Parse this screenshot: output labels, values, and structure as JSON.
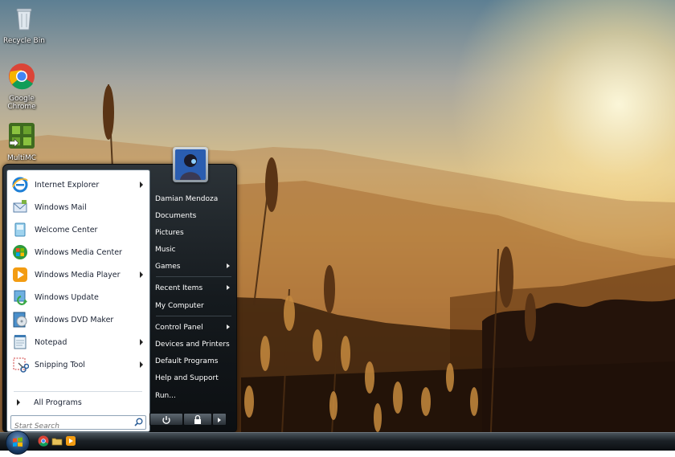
{
  "desktop": {
    "icons": [
      {
        "label": "Recycle Bin",
        "icon": "recycle-bin-icon"
      },
      {
        "label": "Google Chrome",
        "icon": "chrome-icon"
      },
      {
        "label": "MultiMC",
        "icon": "multimc-icon"
      }
    ]
  },
  "start_menu": {
    "programs": [
      {
        "label": "Internet Explorer",
        "icon": "internet-explorer-icon",
        "has_submenu": true
      },
      {
        "label": "Windows Mail",
        "icon": "mail-icon",
        "has_submenu": false
      },
      {
        "label": "Welcome Center",
        "icon": "welcome-center-icon",
        "has_submenu": false
      },
      {
        "label": "Windows Media Center",
        "icon": "media-center-icon",
        "has_submenu": false
      },
      {
        "label": "Windows Media Player",
        "icon": "media-player-icon",
        "has_submenu": true
      },
      {
        "label": "Windows Update",
        "icon": "windows-update-icon",
        "has_submenu": false
      },
      {
        "label": "Windows DVD Maker",
        "icon": "dvd-maker-icon",
        "has_submenu": false
      },
      {
        "label": "Notepad",
        "icon": "notepad-icon",
        "has_submenu": true
      },
      {
        "label": "Snipping Tool",
        "icon": "snipping-tool-icon",
        "has_submenu": true
      }
    ],
    "all_programs": "All Programs",
    "search_placeholder": "Start Search",
    "user_name": "Damian Mendoza",
    "right_items": [
      {
        "label": "Damian Mendoza",
        "has_submenu": false
      },
      {
        "label": "Documents",
        "has_submenu": false
      },
      {
        "label": "Pictures",
        "has_submenu": false
      },
      {
        "label": "Music",
        "has_submenu": false
      },
      {
        "label": "Games",
        "has_submenu": true
      },
      {
        "label": "Recent Items",
        "has_submenu": true
      },
      {
        "label": "My Computer",
        "has_submenu": false
      },
      {
        "label": "Control Panel",
        "has_submenu": true
      },
      {
        "label": "Devices and Printers",
        "has_submenu": false
      },
      {
        "label": "Default Programs",
        "has_submenu": false
      },
      {
        "label": "Help and Support",
        "has_submenu": false
      },
      {
        "label": "Run...",
        "has_submenu": false
      }
    ]
  },
  "taskbar": {
    "start_button": "windows-logo-icon",
    "pinned": [
      "chrome-icon",
      "folder-icon",
      "media-player-icon"
    ]
  },
  "colors": {
    "menu_dark": "#151a1e",
    "menu_text": "#ffffff",
    "program_text": "#1a2233",
    "sky_top": "#5d7f93",
    "sunset": "#e5b45a"
  }
}
